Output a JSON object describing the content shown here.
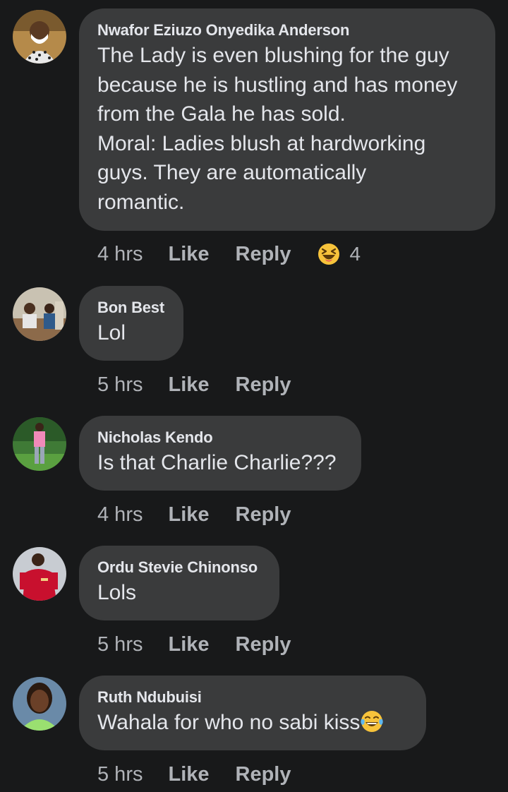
{
  "comments": [
    {
      "author": "Nwafor Eziuzo Onyedika Anderson",
      "text": "The Lady is even blushing for the guy\nbecause he is hustling and has money\nfrom the Gala he has sold.\nMoral: Ladies blush at hardworking\nguys. They are automatically\nromantic.",
      "time": "4 hrs",
      "like": "Like",
      "reply": "Reply",
      "reaction_icon": "laughing-squint-emoji",
      "reaction_count": "4"
    },
    {
      "author": "Bon Best",
      "text": "Lol",
      "time": "5 hrs",
      "like": "Like",
      "reply": "Reply"
    },
    {
      "author": "Nicholas Kendo",
      "text": "Is that Charlie Charlie???",
      "time": "4 hrs",
      "like": "Like",
      "reply": "Reply"
    },
    {
      "author": "Ordu Stevie Chinonso",
      "text": "Lols",
      "time": "5 hrs",
      "like": "Like",
      "reply": "Reply"
    },
    {
      "author": "Ruth Ndubuisi",
      "text": "Wahala for who no sabi kiss",
      "text_emoji": "tears-of-joy-emoji",
      "time": "5 hrs",
      "like": "Like",
      "reply": "Reply"
    }
  ],
  "colors": {
    "background": "#18191a",
    "bubble": "#3a3b3c",
    "text": "#e4e6eb",
    "meta": "#b0b3b8",
    "emoji": "#f7c33b"
  }
}
